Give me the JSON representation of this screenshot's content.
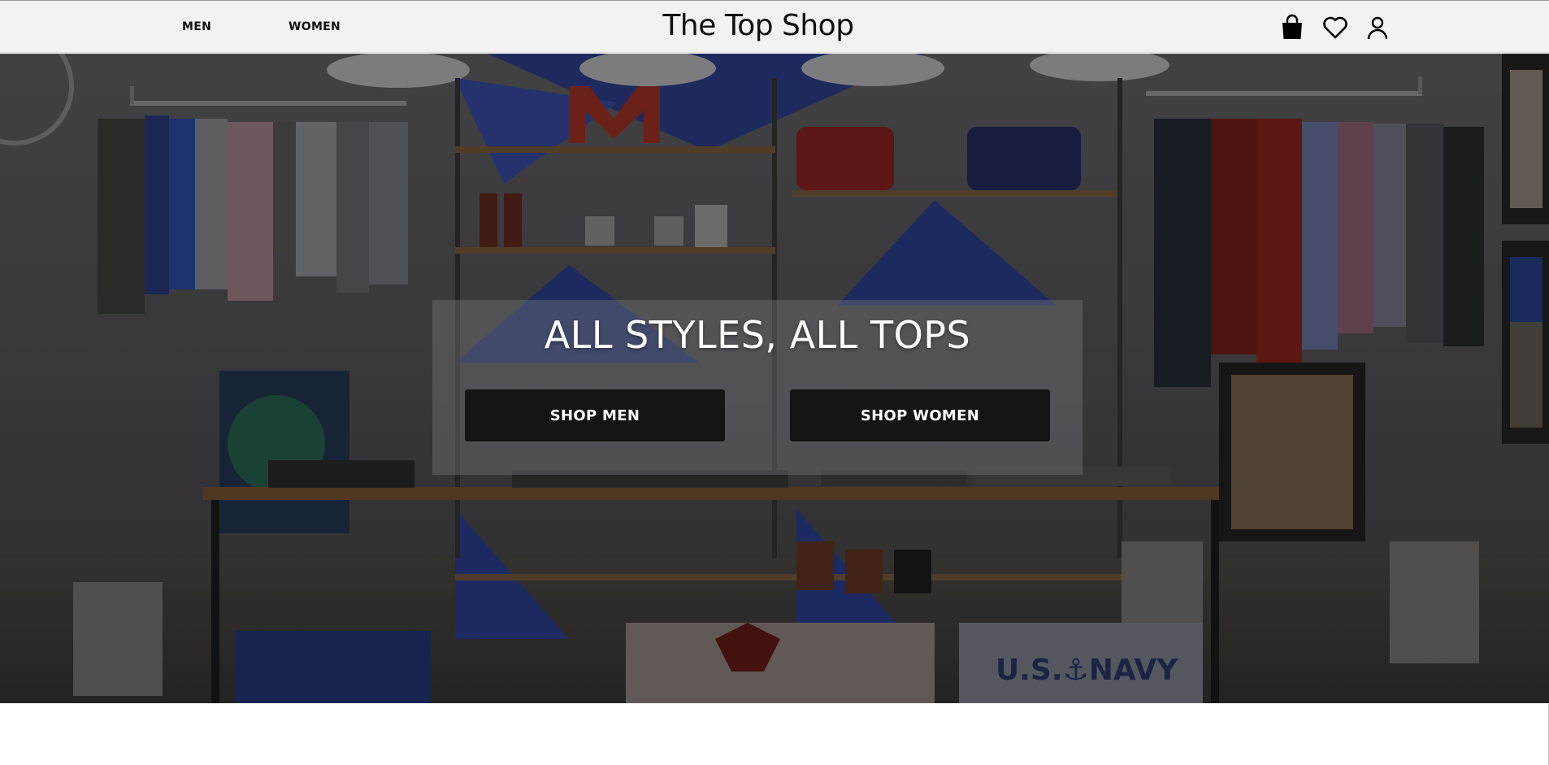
{
  "nav": {
    "links": [
      {
        "label": "MEN"
      },
      {
        "label": "WOMEN"
      }
    ],
    "brand": "The Top Shop",
    "icons": [
      "shopping-bag-icon",
      "heart-icon",
      "user-icon"
    ]
  },
  "hero": {
    "background": "clothing-store-photo",
    "title": "ALL STYLES, ALL TOPS",
    "buttons": [
      {
        "label": "SHOP MEN"
      },
      {
        "label": "SHOP WOMEN"
      }
    ]
  },
  "colors": {
    "nav_bg": "#f2f2f2",
    "button_bg": "#141414",
    "button_text": "#ffffff"
  }
}
